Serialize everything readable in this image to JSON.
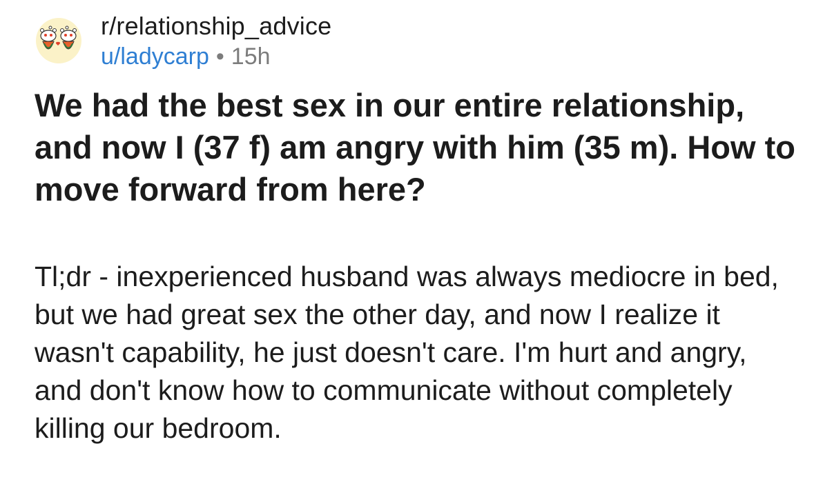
{
  "post": {
    "subreddit": "r/relationship_advice",
    "author": "u/ladycarp",
    "separator": "•",
    "time_ago": "15h",
    "title": "We had the best sex in our entire relationship, and now I (37 f) am angry with him (35 m). How to move forward from here?",
    "body": "Tl;dr - inexperienced husband was always mediocre in bed, but we had great sex the other day, and now I realize it wasn't capability, he just doesn't care. I'm hurt and angry, and don't know how to communicate without completely killing our bedroom."
  },
  "icons": {
    "avatar": "subreddit-snoo-avatar-icon"
  },
  "colors": {
    "author_link": "#2f7fd3",
    "meta_gray": "#7c7c7c",
    "avatar_bg": "#fbf2c8",
    "text": "#1c1c1c"
  }
}
